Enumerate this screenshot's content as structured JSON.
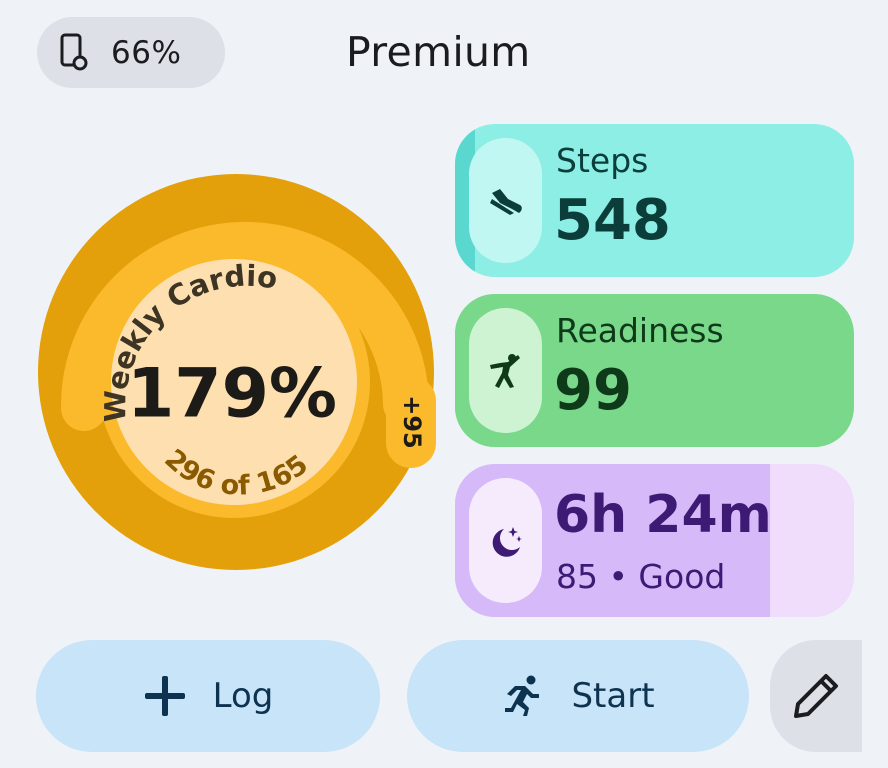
{
  "status": {
    "battery_icon": "watch-battery-icon",
    "battery_text": "66%"
  },
  "header": {
    "title": "Premium"
  },
  "cardio_ring": {
    "title": "Weekly Cardio",
    "percent_text": "179%",
    "progress_text": "296 of 165",
    "bonus_text": "+95",
    "progress_fraction": 1.79,
    "colors": {
      "outer": "#e3a00b",
      "overflow_band": "#fbba2c",
      "inner": "#fee0b0",
      "text_dark": "#1d1b17",
      "text_accent": "#8a5a00"
    }
  },
  "tiles": {
    "steps": {
      "label": "Steps",
      "value": "548",
      "icon": "sneaker-icon",
      "progress_fraction": 0.05
    },
    "readiness": {
      "label": "Readiness",
      "value": "99",
      "icon": "running-figure-icon",
      "progress_fraction": 0.99
    },
    "sleep": {
      "value": "6h 24m",
      "sub": "85 • Good",
      "icon": "moon-stars-icon",
      "progress_fraction": 0.79
    }
  },
  "actions": {
    "log_label": "Log",
    "log_icon": "plus-icon",
    "start_label": "Start",
    "start_icon": "run-icon",
    "edit_icon": "pencil-icon"
  }
}
